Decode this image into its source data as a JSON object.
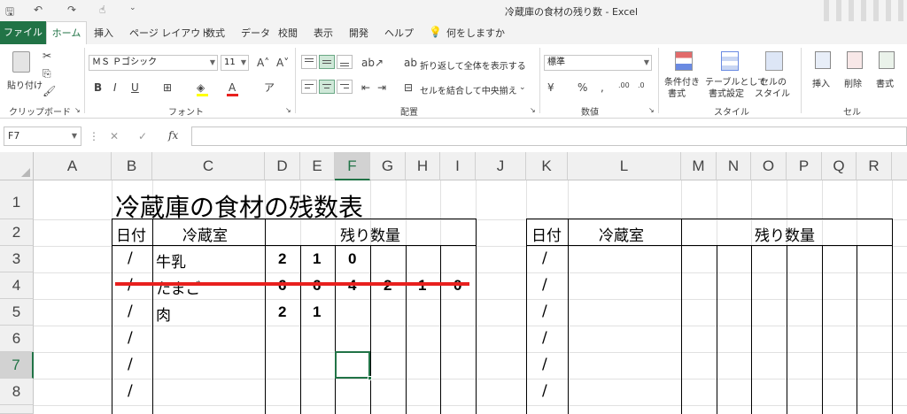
{
  "window": {
    "title": "冷蔵庫の食材の残り数  -  Excel"
  },
  "tabs": [
    "ファイル",
    "ホーム",
    "挿入",
    "ページ レイアウト",
    "数式",
    "データ",
    "校閲",
    "表示",
    "開発",
    "ヘルプ"
  ],
  "tell_me": "何をしますか",
  "ribbon": {
    "clipboard": {
      "paste": "貼り付け",
      "group": "クリップボード"
    },
    "font": {
      "name": "ＭＳ Ｐゴシック",
      "size": "11",
      "bold": "B",
      "italic": "I",
      "underline": "U",
      "group": "フォント"
    },
    "alignment": {
      "wrap": "折り返して全体を表示する",
      "merge": "セルを結合して中央揃え",
      "group": "配置"
    },
    "number": {
      "format": "標準",
      "group": "数値"
    },
    "styles": {
      "cond_line1": "条件付き",
      "cond_line2": "書式",
      "table_line1": "テーブルとして",
      "table_line2": "書式設定",
      "cell_line1": "セルの",
      "cell_line2": "スタイル",
      "group": "スタイル"
    },
    "cells": {
      "insert": "挿入",
      "delete": "削除",
      "format": "書式",
      "group": "セル"
    }
  },
  "formula_bar": {
    "name_box": "F7",
    "fx": "fx",
    "content": ""
  },
  "columns": [
    "A",
    "B",
    "C",
    "D",
    "E",
    "F",
    "G",
    "H",
    "I",
    "J",
    "K",
    "L",
    "M",
    "N",
    "O",
    "P",
    "Q",
    "R"
  ],
  "rows": [
    "1",
    "2",
    "3",
    "4",
    "5",
    "6",
    "7",
    "8"
  ],
  "selected_cell": "F7",
  "sheet": {
    "title": "冷蔵庫の食材の残数表",
    "header_date": "日付",
    "header_fridge": "冷蔵室",
    "header_count": "残り数量",
    "date_slash": "/",
    "items": [
      {
        "name": "牛乳",
        "counts": [
          "2",
          "1",
          "0"
        ]
      },
      {
        "name": "たまご",
        "counts": [
          "6",
          "6",
          "4",
          "2",
          "1",
          "0"
        ],
        "struck": true
      },
      {
        "name": "肉",
        "counts": [
          "2",
          "1"
        ]
      }
    ],
    "strike_color": "#e8201e"
  },
  "colors": {
    "accent": "#217346"
  }
}
